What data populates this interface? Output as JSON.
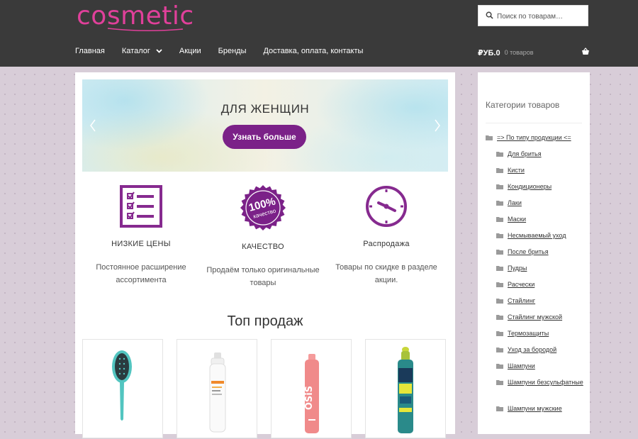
{
  "header": {
    "logo_text": "cosmetic",
    "search_placeholder": "Поиск по товарам…",
    "nav": [
      {
        "label": "Главная"
      },
      {
        "label": "Каталог"
      },
      {
        "label": "Акции"
      },
      {
        "label": "Бренды"
      },
      {
        "label": "Доставка, оплата, контакты"
      }
    ],
    "cart_total": "₽УБ.0",
    "cart_count": "0 товаров"
  },
  "hero": {
    "title": "ДЛЯ ЖЕНЩИН",
    "button_label": "Узнать больше"
  },
  "features": [
    {
      "title": "НИЗКИЕ ЦЕНЫ",
      "desc": "Постоянное расширение ассортимента",
      "icon": "checklist-icon"
    },
    {
      "title": "КАЧЕСТВО",
      "desc": "Продаём только оригинальные товары",
      "icon": "quality-seal-icon",
      "seal_top": "100%",
      "seal_bottom": "качество"
    },
    {
      "title": "Распродажа",
      "desc": "Товары по скидке в разделе акции.",
      "icon": "clock-icon"
    }
  ],
  "section_title": "Топ продаж",
  "sidebar": {
    "title": "Категории товаров",
    "categories": [
      {
        "label": "=> По типу продукции <=",
        "level": 0
      },
      {
        "label": "Для бритья",
        "level": 1
      },
      {
        "label": "Кисти",
        "level": 1
      },
      {
        "label": "Кондиционеры",
        "level": 1
      },
      {
        "label": "Лаки",
        "level": 1
      },
      {
        "label": "Маски",
        "level": 1
      },
      {
        "label": "Несмываемый уход",
        "level": 1
      },
      {
        "label": "После бритья",
        "level": 1
      },
      {
        "label": "Пудры",
        "level": 1
      },
      {
        "label": "Расчески",
        "level": 1
      },
      {
        "label": "Стайлинг",
        "level": 1
      },
      {
        "label": "Стайлинг мужской",
        "level": 1
      },
      {
        "label": "Термозащиты",
        "level": 1
      },
      {
        "label": "Уход за бородой",
        "level": 1
      },
      {
        "label": "Шампуни",
        "level": 1
      },
      {
        "label": "Шампуни безсульфатные",
        "level": 1
      },
      {
        "label": "Шампуни мужские",
        "level": 1
      }
    ]
  },
  "colors": {
    "accent": "#7b2188",
    "logo": "#e0409a",
    "header_bg": "#3a3a3a"
  }
}
